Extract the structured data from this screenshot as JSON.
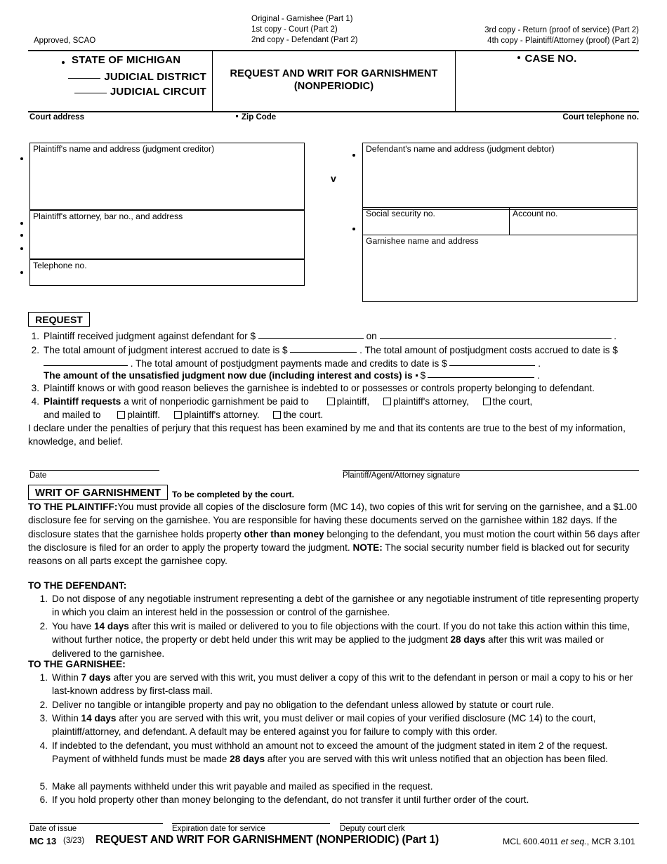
{
  "meta": {
    "approved": "Approved, SCAO"
  },
  "copies": {
    "center": [
      "Original - Garnishee (Part 1)",
      "1st copy - Court (Part 2)",
      "2nd copy - Defendant (Part 2)"
    ],
    "right": [
      "3rd copy - Return (proof of service) (Part 2)",
      "4th copy - Plaintiff/Attorney (proof) (Part 2)"
    ]
  },
  "header": {
    "state": "STATE OF MICHIGAN",
    "judicial_district": "JUDICIAL DISTRICT",
    "judicial_circuit": "JUDICIAL CIRCUIT",
    "form_title_line1": "REQUEST AND WRIT FOR GARNISHMENT",
    "form_title_line2": "(NONPERIODIC)",
    "case_no": "CASE NO."
  },
  "court_line": {
    "address": "Court address",
    "zip": "Zip Code",
    "telephone": "Court telephone no."
  },
  "parties": {
    "plaintiff_name": "Plaintiff's name and address (judgment creditor)",
    "plaintiff_attorney": "Plaintiff's attorney, bar no., and address",
    "telephone": "Telephone no.",
    "versus": "v",
    "defendant_name": "Defendant's name and address (judgment debtor)",
    "ssn": "Social security no.",
    "account_no": "Account no.",
    "garnishee": "Garnishee name and address"
  },
  "request": {
    "heading": "REQUEST",
    "items": [
      {
        "num": "1.",
        "parts": [
          {
            "t": "Plaintiff received judgment against defendant for $"
          },
          {
            "ul": 150
          },
          {
            "t": "on"
          },
          {
            "ul": 330
          },
          {
            "t": "."
          }
        ]
      },
      {
        "num": "2.",
        "parts": [
          {
            "t": "The total amount of judgment interest accrued to date is $"
          },
          {
            "ul": 95
          },
          {
            "t": ". The total amount of postjudgment costs accrued to date is $"
          },
          {
            "ul": 120
          },
          {
            "t": ". The total amount of postjudgment payments made and credits to date is $"
          },
          {
            "ul": 122
          },
          {
            "t": "."
          }
        ]
      }
    ],
    "bold_line": {
      "text": "The amount of the unsatisfied judgment now due (including interest and costs) is",
      "dollar": "$",
      "period": "."
    },
    "item3": {
      "num": "3.",
      "text": "Plaintiff knows or with good reason believes the garnishee is indebted to or possesses or controls property belonging to defendant."
    },
    "item4": {
      "num": "4.",
      "bold_lead": "Plaintiff requests",
      "lead_rest": "a writ of nonperiodic garnishment be paid to",
      "paid_to_options": [
        "plaintiff,",
        "plaintiff's attorney,",
        "the court,"
      ],
      "mailed_lead": "and mailed to",
      "mailed_options": [
        "plaintiff.",
        "plaintiff's attorney.",
        "the court."
      ]
    },
    "declaration": "I declare under the penalties of perjury that this request has been examined by me and that its contents are true to the best of my information, knowledge, and belief."
  },
  "signature_block": {
    "date_caption": "Date",
    "signature_caption": "Plaintiff/Agent/Attorney signature"
  },
  "writ": {
    "heading": "WRIT OF GARNISHMENT",
    "subheading": "To be completed by the court.",
    "to_plaintiff": {
      "label": "TO THE PLAINTIFF:",
      "text_1": "You must provide all copies of the disclosure form (MC 14), two copies of this writ for serving on the garnishee, and a $1.00 disclosure fee for serving on the garnishee. You are responsible for having these documents served on the garnishee within 182 days. If the disclosure states that the garnishee holds property ",
      "bold_1": "other than money",
      "text_2": " belonging to the defendant, you must motion the court within 56 days after the disclosure is filed for an order to apply the property toward the judgment. ",
      "bold_2": "NOTE:",
      "text_3": " The social security number field is blacked out for security reasons on all parts except the garnishee copy."
    },
    "to_defendant": {
      "label": "TO THE DEFENDANT:",
      "items": [
        {
          "num": "1.",
          "segments": [
            {
              "t": "Do not dispose of any negotiable instrument representing a debt of the garnishee or any negotiable instrument of title representing property in which you claim an interest held in the possession or control of the garnishee."
            }
          ]
        },
        {
          "num": "2.",
          "segments": [
            {
              "t": "You have "
            },
            {
              "b": "14 days"
            },
            {
              "t": " after this writ is mailed or delivered to you to file objections with the court. If you do not take this action within this time, without further notice, the property or debt held under this writ may be applied to the judgment "
            },
            {
              "b": "28 days"
            },
            {
              "t": " after this writ was mailed or delivered to the garnishee."
            }
          ]
        }
      ]
    },
    "to_garnishee": {
      "label": "TO THE GARNISHEE:",
      "items": [
        {
          "num": "1.",
          "segments": [
            {
              "t": "Within "
            },
            {
              "b": "7 days"
            },
            {
              "t": " after you are served with this writ, you must deliver a copy of this writ to the defendant in person or mail a copy to his or her last-known address by first-class mail."
            }
          ]
        },
        {
          "num": "2.",
          "segments": [
            {
              "t": "Deliver no tangible or intangible property and pay no obligation to the defendant unless allowed by statute or court rule."
            }
          ]
        },
        {
          "num": "3.",
          "segments": [
            {
              "t": "Within "
            },
            {
              "b": "14 days"
            },
            {
              "t": " after you are served with this writ, you must deliver or mail copies of your verified disclosure (MC 14) to the court, plaintiff/attorney, and defendant. A default may be entered against you for failure to comply with this order."
            }
          ]
        },
        {
          "num": "4.",
          "segments": [
            {
              "t": "If indebted to the defendant, you must withhold an amount not to exceed the amount of the judgment stated in item 2 of the request. Payment of withheld funds must be made "
            },
            {
              "b": "28 days"
            },
            {
              "t": " after you are served with this writ unless notified that an objection has been filed."
            }
          ]
        },
        {
          "num": "5.",
          "segments": [
            {
              "t": "Make all payments withheld under this writ payable and mailed as specified in the request."
            }
          ]
        },
        {
          "num": "6.",
          "segments": [
            {
              "t": "If you hold property other than money belonging to the defendant, do not transfer it until further order of the court."
            }
          ]
        }
      ]
    }
  },
  "footer": {
    "date_of_issue": "Date of issue",
    "expiration": "Expiration date for service",
    "deputy_clerk": "Deputy court clerk",
    "form_code": "MC 13",
    "revision": "(3/23)",
    "title": "REQUEST AND WRIT FOR GARNISHMENT (NONPERIODIC) (Part 1)",
    "citation_a": "MCL 600.4011",
    "citation_italic": "et seq.",
    "citation_b": ", MCR 3.101"
  }
}
